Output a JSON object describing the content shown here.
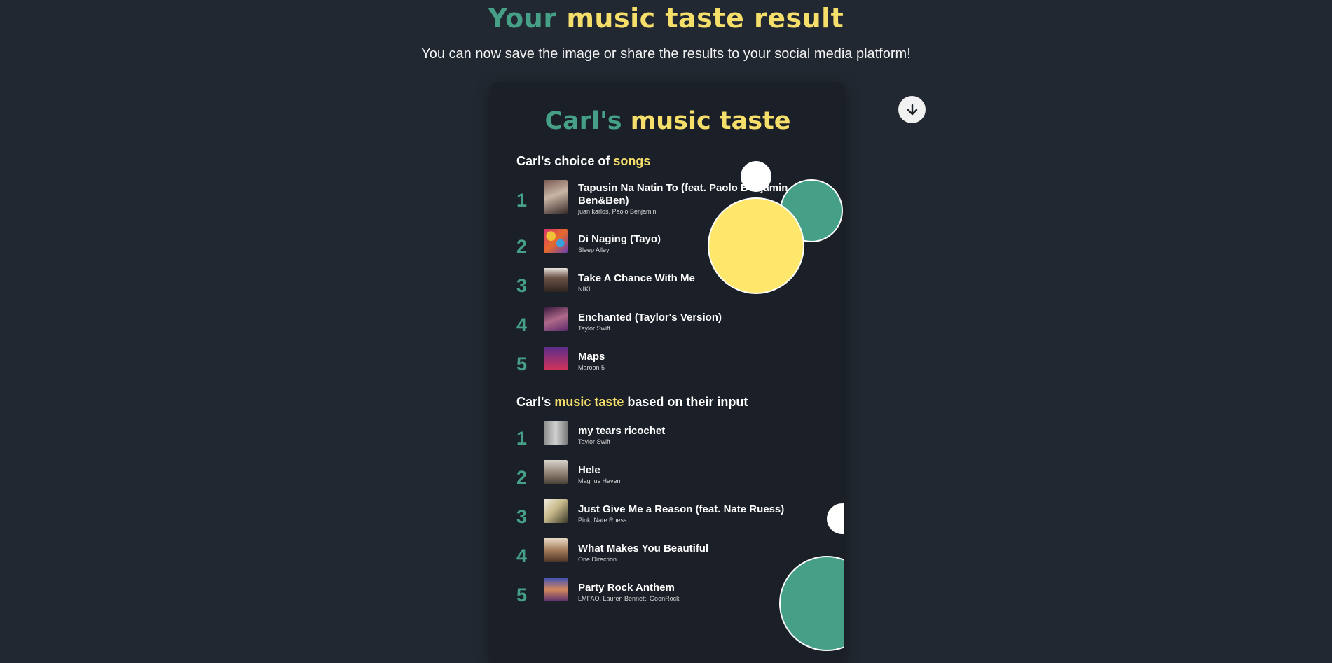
{
  "header": {
    "title_part1": "Your",
    "title_part2": "music taste result",
    "subtitle": "You can now save the image or share the results to your social media platform!"
  },
  "card": {
    "title_part1": "Carl's",
    "title_part2": "music taste",
    "section1": {
      "prefix": "Carl's choice of",
      "highlight": "songs"
    },
    "section2": {
      "prefix": "Carl's",
      "highlight": "music taste",
      "suffix": "based on their input"
    },
    "songs": [
      {
        "rank": "1",
        "title": "Tapusin Na Natin To (feat. Paolo Benjamin of Ben&Ben)",
        "artist": "juan karlos, Paolo Benjamin"
      },
      {
        "rank": "2",
        "title": "Di Naging (Tayo)",
        "artist": "Sleep Alley"
      },
      {
        "rank": "3",
        "title": "Take A Chance With Me",
        "artist": "NIKI"
      },
      {
        "rank": "4",
        "title": "Enchanted (Taylor's Version)",
        "artist": "Taylor Swift"
      },
      {
        "rank": "5",
        "title": "Maps",
        "artist": "Maroon 5"
      }
    ],
    "recommendations": [
      {
        "rank": "1",
        "title": "my tears ricochet",
        "artist": "Taylor Swift"
      },
      {
        "rank": "2",
        "title": "Hele",
        "artist": "Magnus Haven"
      },
      {
        "rank": "3",
        "title": "Just Give Me a Reason (feat. Nate Ruess)",
        "artist": "Pink, Nate Ruess"
      },
      {
        "rank": "4",
        "title": "What Makes You Beautiful",
        "artist": "One Direction"
      },
      {
        "rank": "5",
        "title": "Party Rock Anthem",
        "artist": "LMFAO, Lauren Bennett, GoonRock"
      }
    ]
  },
  "icons": {
    "download": "arrow-down-icon"
  },
  "colors": {
    "background": "#222831",
    "card": "#1b1f28",
    "green": "#45a087",
    "yellow": "#f5df6a"
  }
}
